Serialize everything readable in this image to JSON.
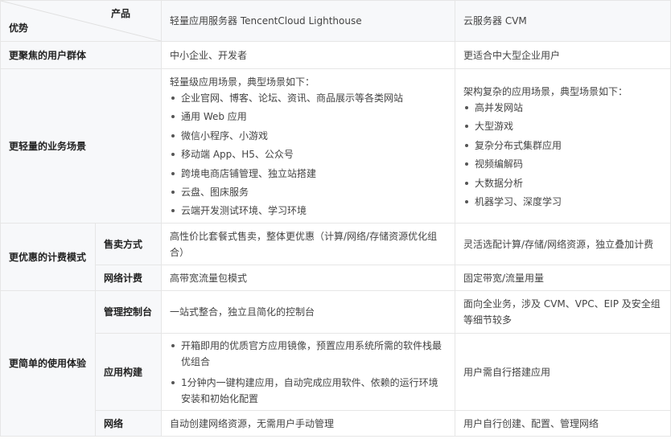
{
  "header": {
    "corner_top": "产品",
    "corner_bottom": "优势",
    "lighthouse": "轻量应用服务器 TencentCloud Lighthouse",
    "cvm": "云服务器 CVM"
  },
  "rows": {
    "audience": {
      "label": "更聚焦的用户群体",
      "lighthouse": "中小企业、开发者",
      "cvm": "更适合中大型企业用户"
    },
    "scenario": {
      "label": "更轻量的业务场景",
      "lighthouse_intro": "轻量级应用场景，典型场景如下：",
      "lighthouse_items": [
        "企业官网、博客、论坛、资讯、商品展示等各类网站",
        "通用 Web 应用",
        "微信小程序、小游戏",
        "移动端 App、H5、公众号",
        "跨境电商店铺管理、独立站搭建",
        "云盘、图床服务",
        "云端开发测试环境、学习环境"
      ],
      "cvm_intro": "架构复杂的应用场景，典型场景如下：",
      "cvm_items": [
        "高并发网站",
        "大型游戏",
        "复杂分布式集群应用",
        "视频编解码",
        "大数据分析",
        "机器学习、深度学习"
      ]
    },
    "billing": {
      "label": "更优惠的计费模式",
      "sales": {
        "label": "售卖方式",
        "lighthouse": "高性价比套餐式售卖，整体更优惠（计算/网络/存储资源优化组合）",
        "cvm": "灵活选配计算/存储/网络资源，独立叠加计费"
      },
      "network": {
        "label": "网络计费",
        "lighthouse": "高带宽流量包模式",
        "cvm": "固定带宽/流量用量"
      }
    },
    "usability": {
      "label": "更简单的使用体验",
      "console": {
        "label": "管理控制台",
        "lighthouse": "一站式整合，独立且简化的控制台",
        "cvm": "面向全业务，涉及 CVM、VPC、EIP 及安全组等细节较多"
      },
      "build": {
        "label": "应用构建",
        "lighthouse_items": [
          "开箱即用的优质官方应用镜像，预置应用系统所需的软件栈最优组合",
          "1分钟内一键构建应用，自动完成应用软件、依赖的运行环境安装和初始化配置"
        ],
        "cvm": "用户需自行搭建应用"
      },
      "net": {
        "label": "网络",
        "lighthouse": "自动创建网络资源，无需用户手动管理",
        "cvm": "用户自行创建、配置、管理网络"
      }
    }
  }
}
